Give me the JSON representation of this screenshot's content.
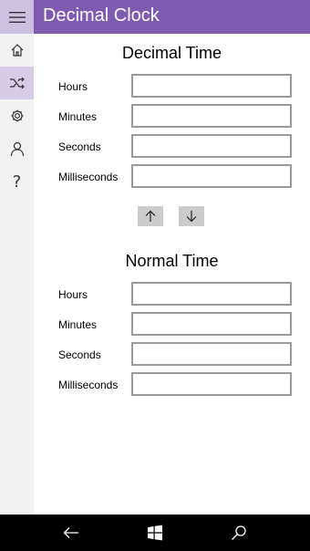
{
  "app": {
    "title": "Decimal Clock"
  },
  "nav": {
    "items": [
      {
        "icon": "hamburger-menu-icon"
      },
      {
        "icon": "home-icon"
      },
      {
        "icon": "shuffle-icon",
        "active": true
      },
      {
        "icon": "gear-icon"
      },
      {
        "icon": "person-icon"
      },
      {
        "icon": "help-icon",
        "glyph": "?"
      }
    ]
  },
  "decimal": {
    "title": "Decimal Time",
    "fields": [
      {
        "label": "Hours",
        "value": ""
      },
      {
        "label": "Minutes",
        "value": ""
      },
      {
        "label": "Seconds",
        "value": ""
      },
      {
        "label": "Milliseconds",
        "value": ""
      }
    ]
  },
  "convert": {
    "up_icon": "arrow-up-icon",
    "down_icon": "arrow-down-icon"
  },
  "normal": {
    "title": "Normal Time",
    "fields": [
      {
        "label": "Hours",
        "value": ""
      },
      {
        "label": "Minutes",
        "value": ""
      },
      {
        "label": "Seconds",
        "value": ""
      },
      {
        "label": "Milliseconds",
        "value": ""
      }
    ]
  },
  "system_nav": {
    "back": "back-icon",
    "start": "windows-icon",
    "search": "search-icon"
  },
  "colors": {
    "accent": "#7e5ab0",
    "rail": "#f2f2f2",
    "active": "#d6cce6"
  }
}
